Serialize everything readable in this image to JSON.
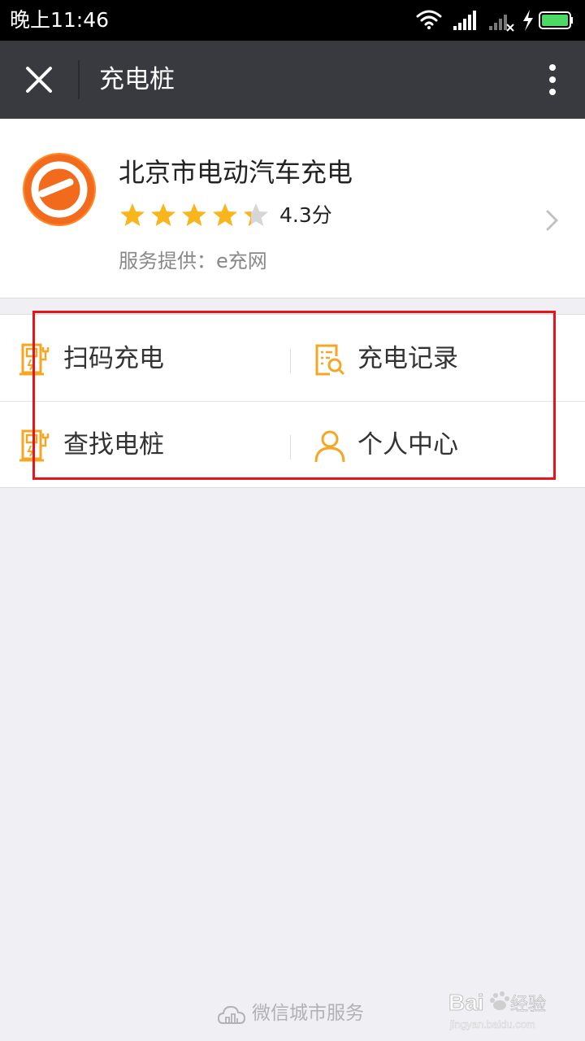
{
  "status_bar": {
    "time": "晚上11:46"
  },
  "navbar": {
    "title": "充电桩"
  },
  "provider": {
    "name": "北京市电动汽车充电",
    "rating": 4.3,
    "rating_text": "4.3分",
    "provided_by": "服务提供：e充网"
  },
  "menu": {
    "items": [
      {
        "label": "扫码充电",
        "icon": "charger-icon"
      },
      {
        "label": "充电记录",
        "icon": "record-search-icon"
      },
      {
        "label": "查找电桩",
        "icon": "charger-icon"
      },
      {
        "label": "个人中心",
        "icon": "person-icon"
      }
    ]
  },
  "footer": {
    "text": "微信城市服务"
  },
  "watermark": {
    "brand": "Bai 经验",
    "url": "jingyan.baidu.com"
  },
  "colors": {
    "accent": "#f5a623",
    "brand_orange": "#f26b1d",
    "navbar": "#393a3f",
    "highlight": "#e8141b",
    "star": "#f8b51c",
    "star_empty": "#d6d6d6"
  }
}
